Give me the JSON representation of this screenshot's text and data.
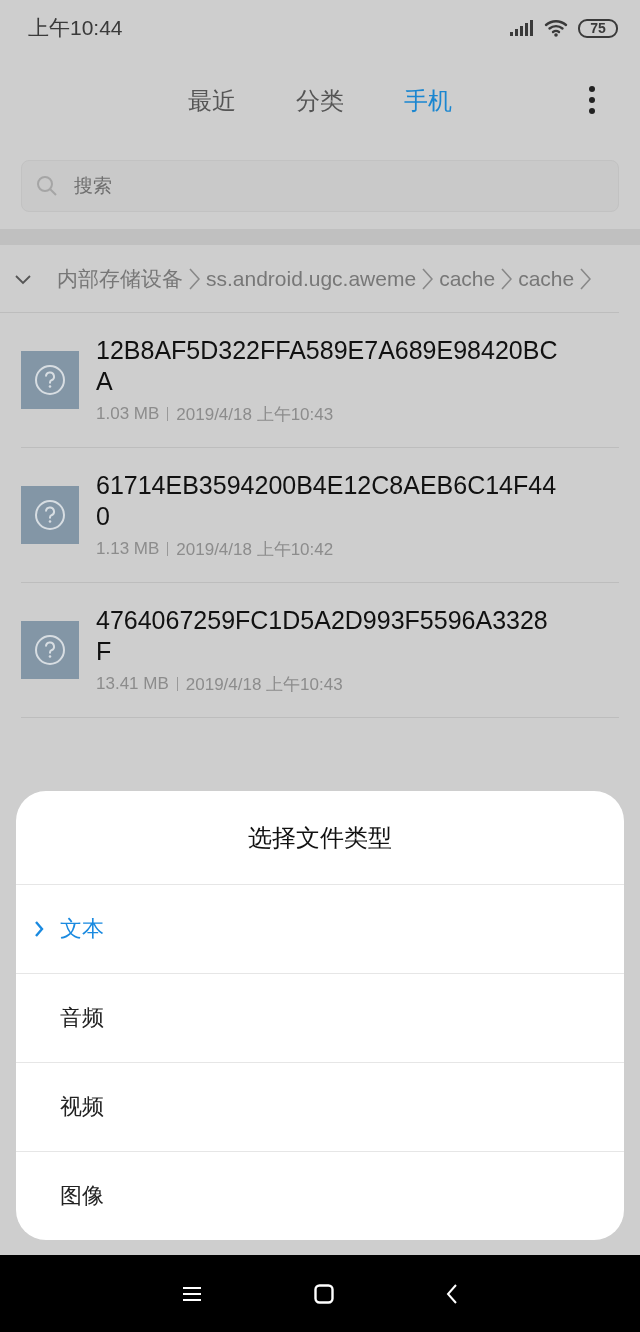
{
  "status_bar": {
    "time": "上午10:44",
    "battery": "75"
  },
  "tabs": [
    {
      "label": "最近",
      "selected": false
    },
    {
      "label": "分类",
      "selected": false
    },
    {
      "label": "手机",
      "selected": true
    }
  ],
  "search": {
    "placeholder": "搜索"
  },
  "breadcrumb": [
    "内部存储设备",
    "ss.android.ugc.aweme",
    "cache",
    "cache"
  ],
  "files": [
    {
      "name": "12B8AF5D322FFA589E7A689E98420BCA",
      "size": "1.03 MB",
      "date": "2019/4/18 上午10:43"
    },
    {
      "name": "61714EB3594200B4E12C8AEB6C14F440",
      "size": "1.13 MB",
      "date": "2019/4/18 上午10:42"
    },
    {
      "name": "4764067259FC1D5A2D993F5596A3328F",
      "size": "13.41 MB",
      "date": "2019/4/18 上午10:43"
    }
  ],
  "sheet": {
    "title": "选择文件类型",
    "options": [
      {
        "label": "文本",
        "selected": true
      },
      {
        "label": "音频",
        "selected": false
      },
      {
        "label": "视频",
        "selected": false
      },
      {
        "label": "图像",
        "selected": false
      }
    ]
  }
}
